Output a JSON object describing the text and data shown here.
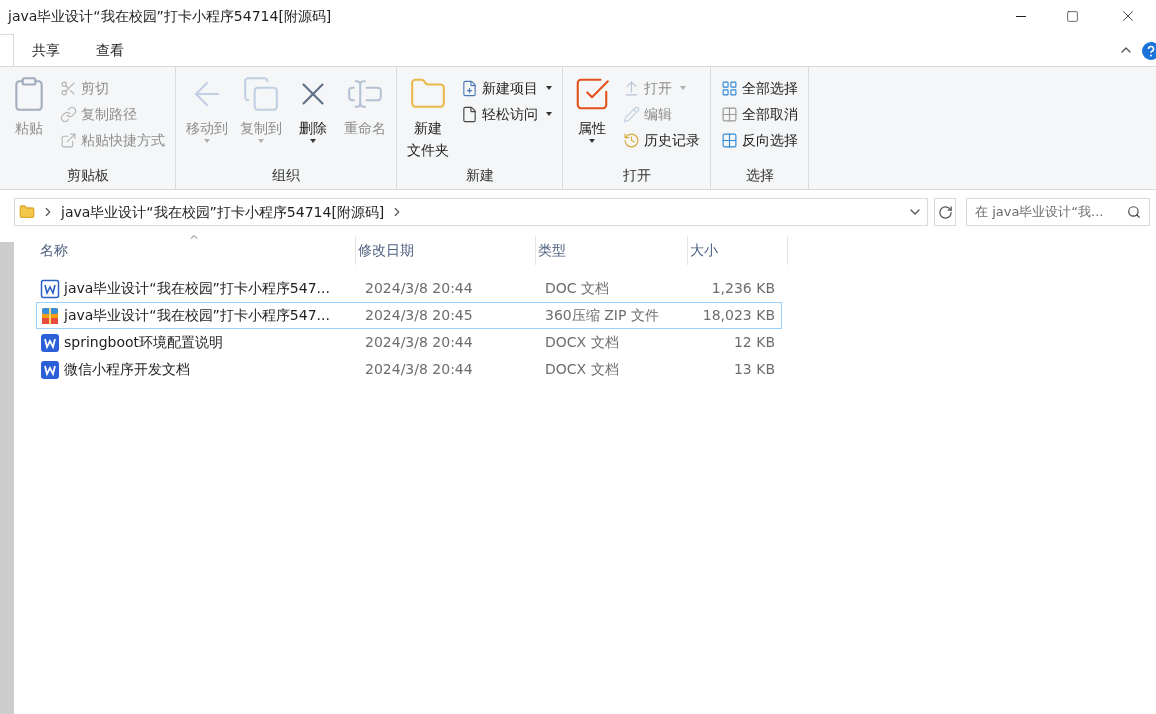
{
  "window": {
    "title": "java毕业设计“我在校园”打卡小程序54714[附源码]"
  },
  "tabs": [
    {
      "label": "共享",
      "selected": false
    },
    {
      "label": "查看",
      "selected": false
    }
  ],
  "ribbon": [
    {
      "label": "剪贴板",
      "items": [
        {
          "kind": "large",
          "label": "粘贴",
          "disabled": true,
          "dropdown": false
        },
        {
          "kind": "small",
          "label": "剪切",
          "disabled": true,
          "dropdown": false
        },
        {
          "kind": "small",
          "label": "复制路径",
          "disabled": true,
          "dropdown": false
        },
        {
          "kind": "small",
          "label": "粘贴快捷方式",
          "disabled": true,
          "dropdown": false
        }
      ]
    },
    {
      "label": "组织",
      "items": [
        {
          "kind": "large",
          "label": "移动到",
          "disabled": true,
          "dropdown": true
        },
        {
          "kind": "large",
          "label": "复制到",
          "disabled": true,
          "dropdown": true
        },
        {
          "kind": "large",
          "label": "删除",
          "disabled": false,
          "dropdown": true
        },
        {
          "kind": "large",
          "label": "重命名",
          "disabled": true,
          "dropdown": false
        }
      ]
    },
    {
      "label": "新建",
      "items": [
        {
          "kind": "large",
          "lines": [
            "新建",
            "文件夹"
          ],
          "disabled": false,
          "dropdown": false
        },
        {
          "kind": "small",
          "label": "新建项目",
          "disabled": false,
          "dropdown": true
        },
        {
          "kind": "small",
          "label": "轻松访问",
          "disabled": false,
          "dropdown": true
        }
      ]
    },
    {
      "label": "打开",
      "items": [
        {
          "kind": "large",
          "label": "属性",
          "disabled": false,
          "dropdown": true
        },
        {
          "kind": "small",
          "label": "打开",
          "disabled": true,
          "dropdown": true
        },
        {
          "kind": "small",
          "label": "编辑",
          "disabled": true,
          "dropdown": false
        },
        {
          "kind": "small",
          "label": "历史记录",
          "disabled": false,
          "dropdown": false
        }
      ]
    },
    {
      "label": "选择",
      "items": [
        {
          "kind": "small",
          "label": "全部选择",
          "disabled": false,
          "dropdown": false
        },
        {
          "kind": "small",
          "label": "全部取消",
          "disabled": false,
          "dropdown": false
        },
        {
          "kind": "small",
          "label": "反向选择",
          "disabled": false,
          "dropdown": false
        }
      ]
    }
  ],
  "address": {
    "path": [
      "java毕业设计“我在校园”打卡小程序54714[附源码]"
    ]
  },
  "search": {
    "placeholder": "在 java毕业设计“我..."
  },
  "table": {
    "columns": [
      "名称",
      "修改日期",
      "类型",
      "大小"
    ],
    "rows": [
      {
        "kind": "doc",
        "name": "java毕业设计“我在校园”打卡小程序547...",
        "date": "2024/3/8 20:44",
        "type": "DOC 文档",
        "size": "1,236 KB",
        "selected": false
      },
      {
        "kind": "zip",
        "name": "java毕业设计“我在校园”打卡小程序547...",
        "date": "2024/3/8 20:45",
        "type": "360压缩 ZIP 文件",
        "size": "18,023 KB",
        "selected": true
      },
      {
        "kind": "docx",
        "name": "springboot环境配置说明",
        "date": "2024/3/8 20:44",
        "type": "DOCX 文档",
        "size": "12 KB",
        "selected": false
      },
      {
        "kind": "docx",
        "name": "微信小程序开发文档",
        "date": "2024/3/8 20:44",
        "type": "DOCX 文档",
        "size": "13 KB",
        "selected": false
      }
    ]
  }
}
